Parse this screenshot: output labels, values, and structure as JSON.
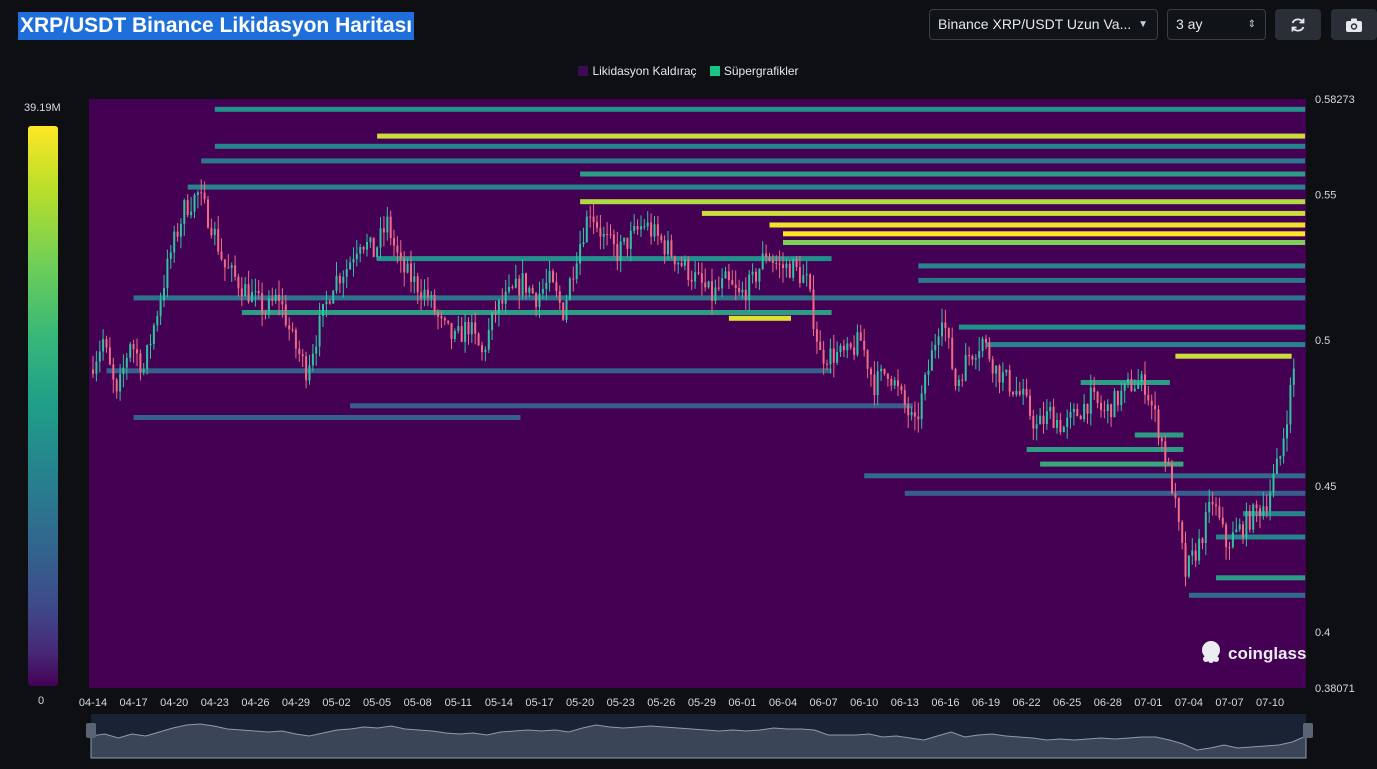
{
  "header": {
    "title": "XRP/USDT Binance Likidasyon Haritası",
    "symbol_select": "Binance XRP/USDT Uzun Va...",
    "range_select": "3 ay",
    "refresh_icon": "refresh-icon",
    "camera_icon": "camera-icon"
  },
  "legend": [
    {
      "label": "Likidasyon Kaldıraç",
      "color": "#3d0a57"
    },
    {
      "label": "Süpergrafikler",
      "color": "#17c684"
    }
  ],
  "colors": {
    "background": "#0d0f13",
    "heatmap_base": "#440154",
    "candle_up": "#2ec4a1",
    "candle_down": "#ef6b86",
    "navigator": "#1a2333"
  },
  "color_scale": {
    "max_label": "39.19M",
    "min_label": "0"
  },
  "watermark": "coinglass",
  "chart_data": {
    "type": "heatmap",
    "title": "XRP/USDT Binance Likidasyon Haritası",
    "x_tick_labels": [
      "04-14",
      "04-17",
      "04-20",
      "04-23",
      "04-26",
      "04-29",
      "05-02",
      "05-05",
      "05-08",
      "05-11",
      "05-14",
      "05-17",
      "05-20",
      "05-23",
      "05-26",
      "05-29",
      "06-01",
      "06-04",
      "06-07",
      "06-10",
      "06-13",
      "06-16",
      "06-19",
      "06-22",
      "06-25",
      "06-28",
      "07-01",
      "07-04",
      "07-07",
      "07-10"
    ],
    "y_tick_labels": [
      "0.58273",
      "0.55",
      "0.5",
      "0.45",
      "0.4",
      "0.38071"
    ],
    "ylim": [
      0.38071,
      0.58273
    ],
    "colorbar_range": [
      0,
      39190000
    ],
    "colorbar_max_label": "39.19M",
    "price_path": [
      {
        "d": "04-14",
        "p": 0.49
      },
      {
        "d": "04-15",
        "p": 0.5
      },
      {
        "d": "04-16",
        "p": 0.48
      },
      {
        "d": "04-17",
        "p": 0.5
      },
      {
        "d": "04-18",
        "p": 0.49
      },
      {
        "d": "04-19",
        "p": 0.51
      },
      {
        "d": "04-20",
        "p": 0.53
      },
      {
        "d": "04-21",
        "p": 0.545
      },
      {
        "d": "04-22",
        "p": 0.55
      },
      {
        "d": "04-23",
        "p": 0.54
      },
      {
        "d": "04-24",
        "p": 0.525
      },
      {
        "d": "04-25",
        "p": 0.52
      },
      {
        "d": "04-26",
        "p": 0.515
      },
      {
        "d": "04-27",
        "p": 0.51
      },
      {
        "d": "04-28",
        "p": 0.515
      },
      {
        "d": "04-29",
        "p": 0.5
      },
      {
        "d": "04-30",
        "p": 0.49
      },
      {
        "d": "05-01",
        "p": 0.505
      },
      {
        "d": "05-02",
        "p": 0.52
      },
      {
        "d": "05-03",
        "p": 0.525
      },
      {
        "d": "05-04",
        "p": 0.535
      },
      {
        "d": "05-05",
        "p": 0.53
      },
      {
        "d": "05-06",
        "p": 0.54
      },
      {
        "d": "05-07",
        "p": 0.525
      },
      {
        "d": "05-08",
        "p": 0.52
      },
      {
        "d": "05-09",
        "p": 0.515
      },
      {
        "d": "05-10",
        "p": 0.505
      },
      {
        "d": "05-11",
        "p": 0.5
      },
      {
        "d": "05-12",
        "p": 0.505
      },
      {
        "d": "05-13",
        "p": 0.495
      },
      {
        "d": "05-14",
        "p": 0.51
      },
      {
        "d": "05-15",
        "p": 0.515
      },
      {
        "d": "05-16",
        "p": 0.52
      },
      {
        "d": "05-17",
        "p": 0.515
      },
      {
        "d": "05-18",
        "p": 0.52
      },
      {
        "d": "05-19",
        "p": 0.51
      },
      {
        "d": "05-20",
        "p": 0.53
      },
      {
        "d": "05-21",
        "p": 0.545
      },
      {
        "d": "05-22",
        "p": 0.535
      },
      {
        "d": "05-23",
        "p": 0.53
      },
      {
        "d": "05-24",
        "p": 0.535
      },
      {
        "d": "05-25",
        "p": 0.54
      },
      {
        "d": "05-26",
        "p": 0.535
      },
      {
        "d": "05-27",
        "p": 0.53
      },
      {
        "d": "05-28",
        "p": 0.525
      },
      {
        "d": "05-29",
        "p": 0.52
      },
      {
        "d": "05-30",
        "p": 0.515
      },
      {
        "d": "05-31",
        "p": 0.52
      },
      {
        "d": "06-01",
        "p": 0.515
      },
      {
        "d": "06-02",
        "p": 0.52
      },
      {
        "d": "06-03",
        "p": 0.53
      },
      {
        "d": "06-04",
        "p": 0.525
      },
      {
        "d": "06-05",
        "p": 0.525
      },
      {
        "d": "06-06",
        "p": 0.52
      },
      {
        "d": "06-07",
        "p": 0.495
      },
      {
        "d": "06-08",
        "p": 0.495
      },
      {
        "d": "06-09",
        "p": 0.495
      },
      {
        "d": "06-10",
        "p": 0.5
      },
      {
        "d": "06-11",
        "p": 0.485
      },
      {
        "d": "06-12",
        "p": 0.49
      },
      {
        "d": "06-13",
        "p": 0.48
      },
      {
        "d": "06-14",
        "p": 0.47
      },
      {
        "d": "06-15",
        "p": 0.49
      },
      {
        "d": "06-16",
        "p": 0.51
      },
      {
        "d": "06-17",
        "p": 0.485
      },
      {
        "d": "06-18",
        "p": 0.495
      },
      {
        "d": "06-19",
        "p": 0.5
      },
      {
        "d": "06-20",
        "p": 0.49
      },
      {
        "d": "06-21",
        "p": 0.485
      },
      {
        "d": "06-22",
        "p": 0.48
      },
      {
        "d": "06-23",
        "p": 0.47
      },
      {
        "d": "06-24",
        "p": 0.475
      },
      {
        "d": "06-25",
        "p": 0.47
      },
      {
        "d": "06-26",
        "p": 0.475
      },
      {
        "d": "06-27",
        "p": 0.48
      },
      {
        "d": "06-28",
        "p": 0.475
      },
      {
        "d": "06-29",
        "p": 0.48
      },
      {
        "d": "06-30",
        "p": 0.485
      },
      {
        "d": "07-01",
        "p": 0.485
      },
      {
        "d": "07-02",
        "p": 0.47
      },
      {
        "d": "07-03",
        "p": 0.45
      },
      {
        "d": "07-04",
        "p": 0.42
      },
      {
        "d": "07-05",
        "p": 0.43
      },
      {
        "d": "07-06",
        "p": 0.445
      },
      {
        "d": "07-07",
        "p": 0.43
      },
      {
        "d": "07-08",
        "p": 0.435
      },
      {
        "d": "07-09",
        "p": 0.44
      },
      {
        "d": "07-10",
        "p": 0.445
      },
      {
        "d": "07-11",
        "p": 0.46
      },
      {
        "d": "07-12",
        "p": 0.49
      }
    ],
    "liquidation_bands": [
      {
        "price": 0.5792,
        "from": "04-23",
        "to": "07-12",
        "intensity": 0.5
      },
      {
        "price": 0.57,
        "from": "05-05",
        "to": "07-12",
        "intensity": 0.92
      },
      {
        "price": 0.5665,
        "from": "04-23",
        "to": "07-12",
        "intensity": 0.45
      },
      {
        "price": 0.5615,
        "from": "04-22",
        "to": "07-12",
        "intensity": 0.4
      },
      {
        "price": 0.557,
        "from": "05-20",
        "to": "07-12",
        "intensity": 0.55
      },
      {
        "price": 0.5525,
        "from": "04-21",
        "to": "07-12",
        "intensity": 0.45
      },
      {
        "price": 0.5475,
        "from": "05-20",
        "to": "07-12",
        "intensity": 0.88
      },
      {
        "price": 0.5435,
        "from": "05-29",
        "to": "07-12",
        "intensity": 0.92
      },
      {
        "price": 0.5395,
        "from": "06-03",
        "to": "07-12",
        "intensity": 0.98
      },
      {
        "price": 0.5365,
        "from": "06-04",
        "to": "07-12",
        "intensity": 1.0
      },
      {
        "price": 0.5335,
        "from": "06-04",
        "to": "07-12",
        "intensity": 0.8
      },
      {
        "price": 0.528,
        "from": "05-05",
        "to": "06-07",
        "intensity": 0.5
      },
      {
        "price": 0.5255,
        "from": "06-14",
        "to": "07-12",
        "intensity": 0.45
      },
      {
        "price": 0.5205,
        "from": "06-14",
        "to": "07-12",
        "intensity": 0.4
      },
      {
        "price": 0.5145,
        "from": "04-17",
        "to": "07-12",
        "intensity": 0.38
      },
      {
        "price": 0.5095,
        "from": "04-25",
        "to": "06-07",
        "intensity": 0.55
      },
      {
        "price": 0.5075,
        "from": "05-31",
        "to": "06-04",
        "intensity": 0.95
      },
      {
        "price": 0.5045,
        "from": "06-17",
        "to": "07-12",
        "intensity": 0.5
      },
      {
        "price": 0.4985,
        "from": "06-19",
        "to": "07-12",
        "intensity": 0.45
      },
      {
        "price": 0.4945,
        "from": "07-03",
        "to": "07-11",
        "intensity": 0.92
      },
      {
        "price": 0.4895,
        "from": "04-15",
        "to": "06-07",
        "intensity": 0.3
      },
      {
        "price": 0.4855,
        "from": "06-26",
        "to": "07-02",
        "intensity": 0.55
      },
      {
        "price": 0.4775,
        "from": "05-03",
        "to": "06-13",
        "intensity": 0.3
      },
      {
        "price": 0.4735,
        "from": "04-17",
        "to": "05-15",
        "intensity": 0.3
      },
      {
        "price": 0.4675,
        "from": "06-30",
        "to": "07-03",
        "intensity": 0.55
      },
      {
        "price": 0.4625,
        "from": "06-22",
        "to": "07-03",
        "intensity": 0.55
      },
      {
        "price": 0.4575,
        "from": "06-23",
        "to": "07-03",
        "intensity": 0.6
      },
      {
        "price": 0.4535,
        "from": "06-10",
        "to": "07-12",
        "intensity": 0.35
      },
      {
        "price": 0.4475,
        "from": "06-13",
        "to": "07-12",
        "intensity": 0.3
      },
      {
        "price": 0.4405,
        "from": "07-08",
        "to": "07-12",
        "intensity": 0.45
      },
      {
        "price": 0.4325,
        "from": "07-06",
        "to": "07-12",
        "intensity": 0.45
      },
      {
        "price": 0.4185,
        "from": "07-06",
        "to": "07-12",
        "intensity": 0.55
      },
      {
        "price": 0.4125,
        "from": "07-04",
        "to": "07-12",
        "intensity": 0.35
      }
    ]
  }
}
